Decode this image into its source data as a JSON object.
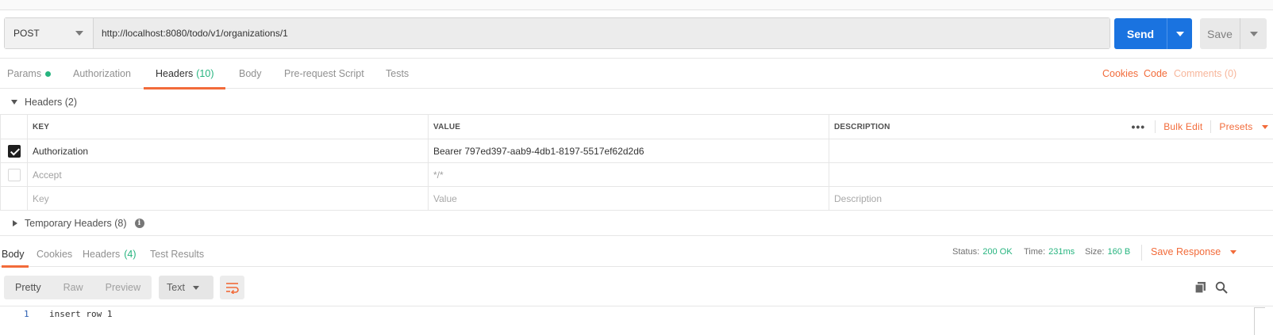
{
  "request": {
    "method": "POST",
    "url": "http://localhost:8080/todo/v1/organizations/1",
    "send_label": "Send",
    "save_label": "Save"
  },
  "request_tabs": {
    "params": "Params",
    "authorization": "Authorization",
    "headers": "Headers",
    "headers_count": "(10)",
    "body": "Body",
    "prerequest": "Pre-request Script",
    "tests": "Tests",
    "cookies": "Cookies",
    "code": "Code",
    "comments": "Comments (0)"
  },
  "headers_section": {
    "title": "Headers (2)",
    "columns": {
      "key": "KEY",
      "value": "VALUE",
      "description": "DESCRIPTION"
    },
    "more": "•••",
    "bulk_edit": "Bulk Edit",
    "presets": "Presets",
    "rows": [
      {
        "key": "Authorization",
        "value": "Bearer 797ed397-aab9-4db1-8197-5517ef62d2d6",
        "description": "",
        "checked": true
      },
      {
        "key": "Accept",
        "value": "*/*",
        "description": "",
        "checked": false
      }
    ],
    "placeholder": {
      "key": "Key",
      "value": "Value",
      "description": "Description"
    },
    "temporary": "Temporary Headers (8)"
  },
  "response": {
    "tabs": {
      "body": "Body",
      "cookies": "Cookies",
      "headers": "Headers",
      "headers_count": "(4)",
      "test_results": "Test Results"
    },
    "status_label": "Status:",
    "status_value": "200 OK",
    "time_label": "Time:",
    "time_value": "231ms",
    "size_label": "Size:",
    "size_value": "160 B",
    "save_response": "Save Response",
    "view_modes": {
      "pretty": "Pretty",
      "raw": "Raw",
      "preview": "Preview"
    },
    "format": "Text",
    "line_number": "1",
    "body_text": "insert row 1"
  },
  "colors": {
    "accent": "#f26b3a",
    "primary": "#1a73e0",
    "success": "#26b47f"
  }
}
